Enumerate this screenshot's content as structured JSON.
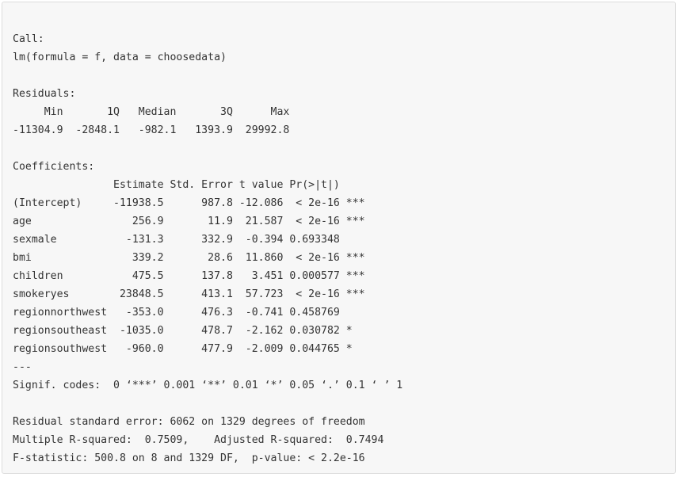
{
  "output": {
    "lines": [
      "Call:",
      "lm(formula = f, data = choosedata)",
      "",
      "Residuals:",
      "     Min       1Q   Median       3Q      Max ",
      "-11304.9  -2848.1   -982.1   1393.9  29992.8 ",
      "",
      "Coefficients:",
      "                Estimate Std. Error t value Pr(>|t|)    ",
      "(Intercept)     -11938.5      987.8 -12.086  < 2e-16 ***",
      "age                256.9       11.9  21.587  < 2e-16 ***",
      "sexmale           -131.3      332.9  -0.394 0.693348    ",
      "bmi                339.2       28.6  11.860  < 2e-16 ***",
      "children           475.5      137.8   3.451 0.000577 ***",
      "smokeryes        23848.5      413.1  57.723  < 2e-16 ***",
      "regionnorthwest   -353.0      476.3  -0.741 0.458769    ",
      "regionsoutheast  -1035.0      478.7  -2.162 0.030782 *  ",
      "regionsouthwest   -960.0      477.9  -2.009 0.044765 *  ",
      "---",
      "Signif. codes:  0 ‘***’ 0.001 ‘**’ 0.01 ‘*’ 0.05 ‘.’ 0.1 ‘ ’ 1",
      "",
      "Residual standard error: 6062 on 1329 degrees of freedom",
      "Multiple R-squared:  0.7509,    Adjusted R-squared:  0.7494 ",
      "F-statistic: 500.8 on 8 and 1329 DF,  p-value: < 2.2e-16"
    ]
  }
}
